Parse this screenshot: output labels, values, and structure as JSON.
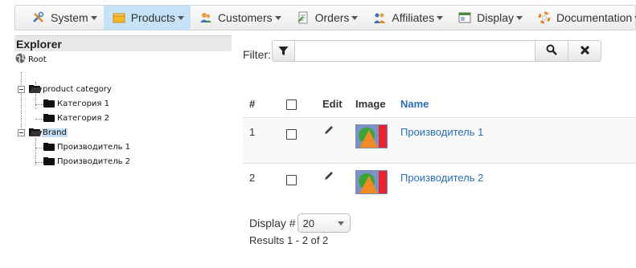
{
  "menu": {
    "items": [
      {
        "label": "System",
        "icon": "tools-icon"
      },
      {
        "label": "Products",
        "icon": "box-icon",
        "active": true
      },
      {
        "label": "Customers",
        "icon": "users-icon"
      },
      {
        "label": "Orders",
        "icon": "document-icon"
      },
      {
        "label": "Affiliates",
        "icon": "people-icon"
      },
      {
        "label": "Display",
        "icon": "monitor-icon"
      },
      {
        "label": "Documentation",
        "icon": "lifebuoy-icon"
      }
    ]
  },
  "explorer": {
    "title": "Explorer",
    "tree": {
      "root": "Root",
      "nodes": [
        {
          "label": "product category",
          "children": [
            "Категория 1",
            "Категория 2"
          ]
        },
        {
          "label": "Brand",
          "selected": true,
          "children": [
            "Производитель 1",
            "Производитель 2"
          ]
        }
      ]
    }
  },
  "filter": {
    "label": "Filter:",
    "value": "",
    "placeholder": ""
  },
  "grid": {
    "headers": {
      "number": "#",
      "edit": "Edit",
      "image": "Image",
      "name": "Name"
    },
    "rows": [
      {
        "number": "1",
        "name": "Производитель 1"
      },
      {
        "number": "2",
        "name": "Производитель 2"
      }
    ]
  },
  "pagination": {
    "display_label": "Display #",
    "display_value": "20",
    "results_text": "Results 1 - 2 of 2"
  },
  "colors": {
    "link": "#2a6fb5",
    "active_menu": "#c6e2f6",
    "thumb_blue": "#7b93c4",
    "thumb_red": "#e8252f",
    "thumb_orange": "#f08a24",
    "thumb_green": "#3aa43a"
  }
}
